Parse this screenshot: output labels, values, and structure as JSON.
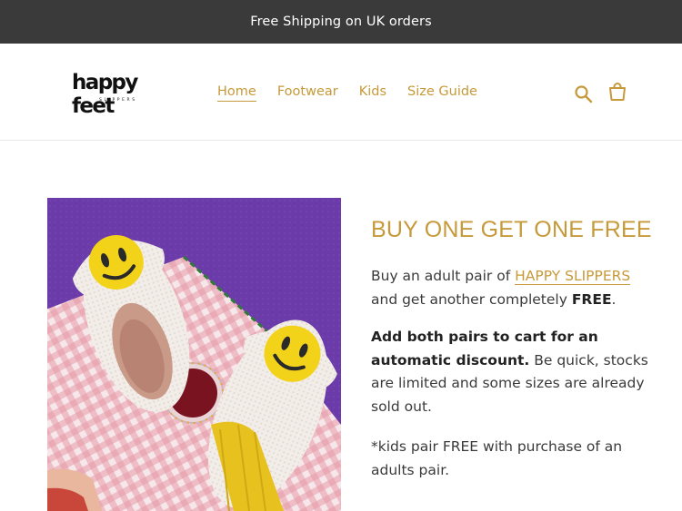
{
  "announcement": {
    "text": "Free Shipping on UK orders"
  },
  "logo": {
    "main": "happy feet",
    "sub": "SLIPPERS"
  },
  "nav": {
    "items": [
      {
        "label": "Home",
        "active": true
      },
      {
        "label": "Footwear"
      },
      {
        "label": "Kids"
      },
      {
        "label": "Size Guide"
      }
    ]
  },
  "icons": {
    "search": "search-icon",
    "cart": "cart-icon"
  },
  "colors": {
    "accent": "#c69a3a",
    "announcement_bg": "#3a3a3a",
    "text": "#3a3a3a"
  },
  "promo": {
    "title": "BUY ONE GET ONE FREE",
    "p1_pre": "Buy an adult pair of ",
    "p1_link": "HAPPY SLIPPERS",
    "p1_mid": " and get another completely ",
    "p1_bold": "FREE",
    "p1_post": ".",
    "p2_bold": "Add both pairs to cart for an automatic discount.",
    "p2_rest": " Be quick, stocks are limited and some sizes are already sold out.",
    "p3": "*kids pair FREE with purchase of an adults pair."
  },
  "image": {
    "alt": "Smiley face slippers on a gingham cloth"
  }
}
